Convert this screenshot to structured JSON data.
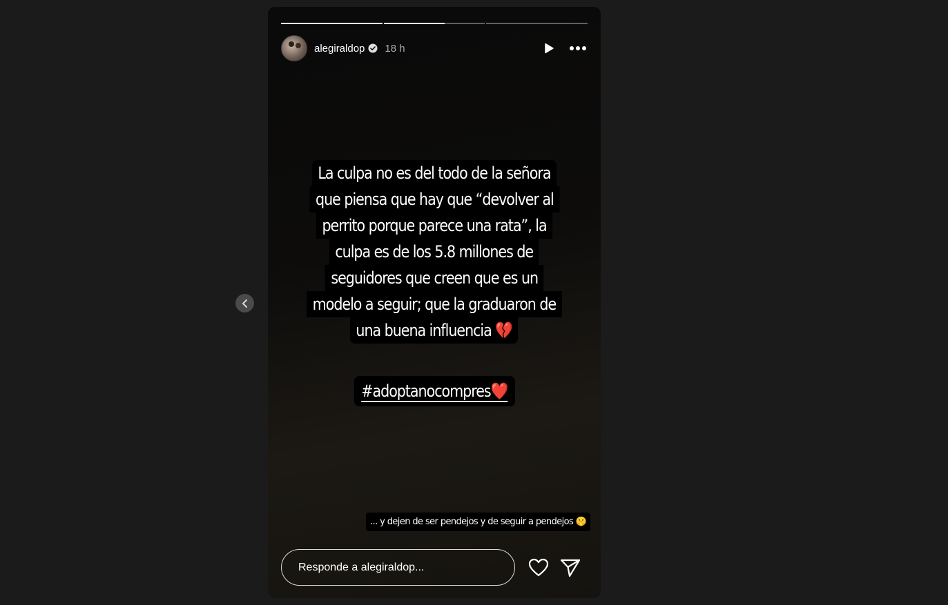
{
  "story": {
    "progress": [
      1.0,
      0.6,
      0.0
    ],
    "user": {
      "username": "alegiraldop",
      "verified": true,
      "time": "18 h",
      "avatar_icon": "profile-photo"
    },
    "controls": {
      "play_icon": "play-icon",
      "more_icon": "more-options-icon"
    },
    "text_lines": [
      "La culpa no es del todo de la señora",
      "que piensa que hay que “devolver al",
      "perrito porque parece una rata”, la",
      "culpa es de los 5.8 millones de",
      "seguidores que creen que es un",
      "modelo a seguir; que la graduaron de",
      "una buena influencia 💔"
    ],
    "hashtag": "#adoptanocompres❤️",
    "caption": "... y dejen de ser pendejos y de seguir a pendejos 🤫",
    "reply_placeholder": "Responde a alegiraldop...",
    "colors": {
      "page_bg": "#1b1b1b",
      "text": "#ffffff",
      "muted": "#a8a8a8"
    }
  },
  "nav": {
    "prev_icon": "chevron-left-icon"
  }
}
